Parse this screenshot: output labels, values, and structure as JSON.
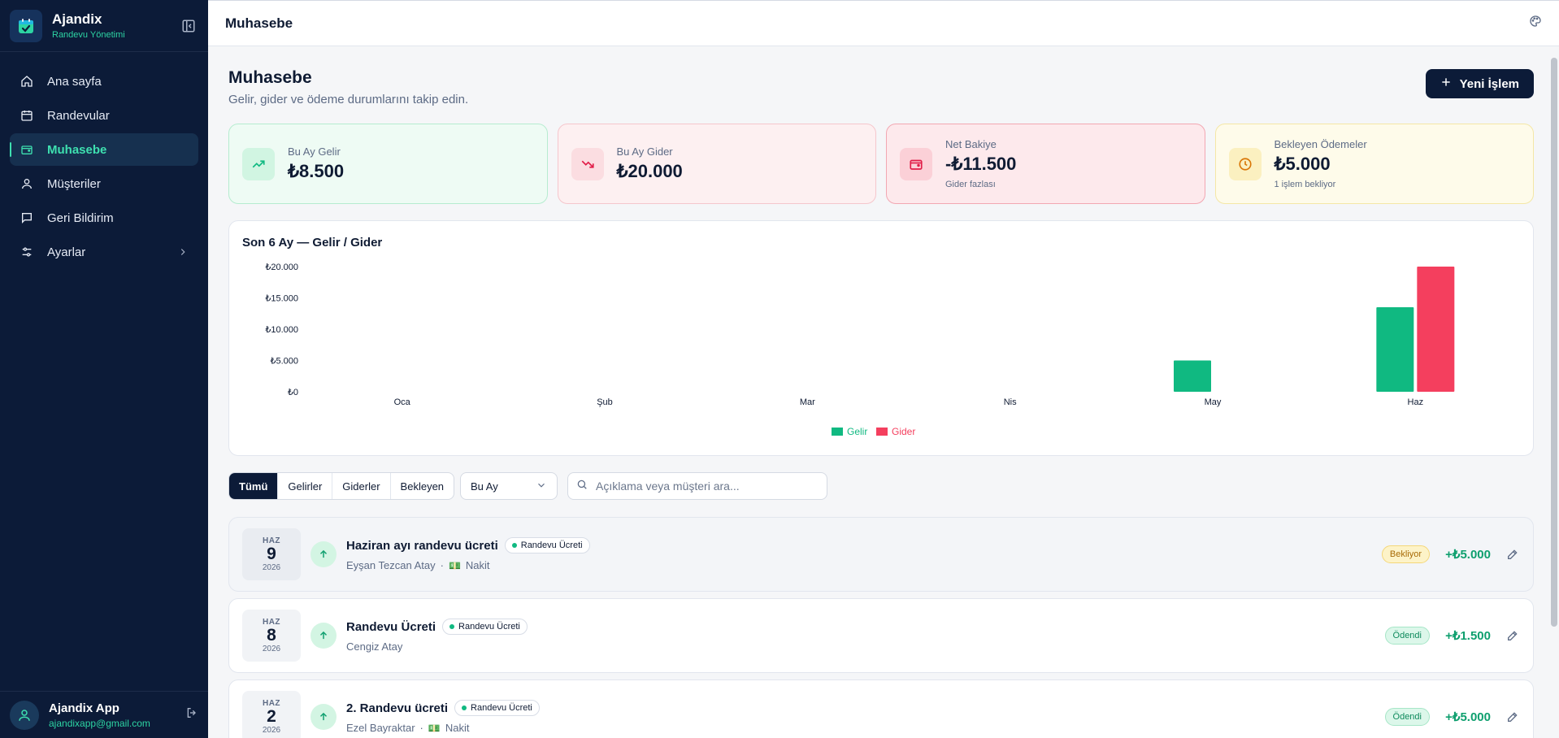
{
  "brand": {
    "title": "Ajandix",
    "subtitle": "Randevu Yönetimi"
  },
  "sidebar": {
    "items": [
      {
        "label": "Ana sayfa",
        "icon": "home-icon"
      },
      {
        "label": "Randevular",
        "icon": "calendar-icon"
      },
      {
        "label": "Muhasebe",
        "icon": "wallet-icon",
        "active": true
      },
      {
        "label": "Müşteriler",
        "icon": "user-icon"
      },
      {
        "label": "Geri Bildirim",
        "icon": "message-icon"
      },
      {
        "label": "Ayarlar",
        "icon": "settings-icon"
      }
    ]
  },
  "user": {
    "name": "Ajandix App",
    "email": "ajandixapp@gmail.com"
  },
  "topbar": {
    "title": "Muhasebe"
  },
  "page": {
    "title": "Muhasebe",
    "description": "Gelir, gider ve ödeme durumlarını takip edin.",
    "new_button": "Yeni İşlem"
  },
  "cards": [
    {
      "label": "Bu Ay Gelir",
      "value": "₺8.500",
      "note": "",
      "color": "#10b981"
    },
    {
      "label": "Bu Ay Gider",
      "value": "₺20.000",
      "note": "",
      "color": "#e11d48"
    },
    {
      "label": "Net Bakiye",
      "value": "-₺11.500",
      "note": "Gider fazlası",
      "color": "#e11d48"
    },
    {
      "label": "Bekleyen Ödemeler",
      "value": "₺5.000",
      "note": "1 işlem bekliyor",
      "color": "#d97706"
    }
  ],
  "chart_data": {
    "type": "bar",
    "title": "Son 6 Ay — Gelir / Gider",
    "categories": [
      "Oca",
      "Şub",
      "Mar",
      "Nis",
      "May",
      "Haz"
    ],
    "series": [
      {
        "name": "Gelir",
        "color": "#10b981",
        "values": [
          0,
          0,
          0,
          0,
          5000,
          13500
        ]
      },
      {
        "name": "Gider",
        "color": "#f43f5e",
        "values": [
          0,
          0,
          0,
          0,
          0,
          20000
        ]
      }
    ],
    "yticks": [
      "₺0",
      "₺5.000",
      "₺10.000",
      "₺15.000",
      "₺20.000"
    ],
    "ylim": [
      0,
      20000
    ],
    "legend": "bottom-center",
    "grid": false
  },
  "filters": {
    "tabs": [
      "Tümü",
      "Gelirler",
      "Giderler",
      "Bekleyen"
    ],
    "active_tab": "Tümü",
    "period": "Bu Ay",
    "search_placeholder": "Açıklama veya müşteri ara..."
  },
  "transactions": [
    {
      "month": "HAZ",
      "day": "9",
      "year": "2026",
      "title": "Haziran ayı randevu ücreti",
      "tag": "Randevu Ücreti",
      "customer": "Eyşan Tezcan Atay",
      "separator": "·",
      "method": "Nakit",
      "status": "Bekliyor",
      "amount": "+₺5.000"
    },
    {
      "month": "HAZ",
      "day": "8",
      "year": "2026",
      "title": "Randevu Ücreti",
      "tag": "Randevu Ücreti",
      "customer": "Cengiz Atay",
      "separator": "",
      "method": "",
      "status": "Ödendi",
      "amount": "+₺1.500"
    },
    {
      "month": "HAZ",
      "day": "2",
      "year": "2026",
      "title": "2. Randevu ücreti",
      "tag": "Randevu Ücreti",
      "customer": "Ezel Bayraktar",
      "separator": "·",
      "method": "Nakit",
      "status": "Ödendi",
      "amount": "+₺5.000"
    }
  ]
}
